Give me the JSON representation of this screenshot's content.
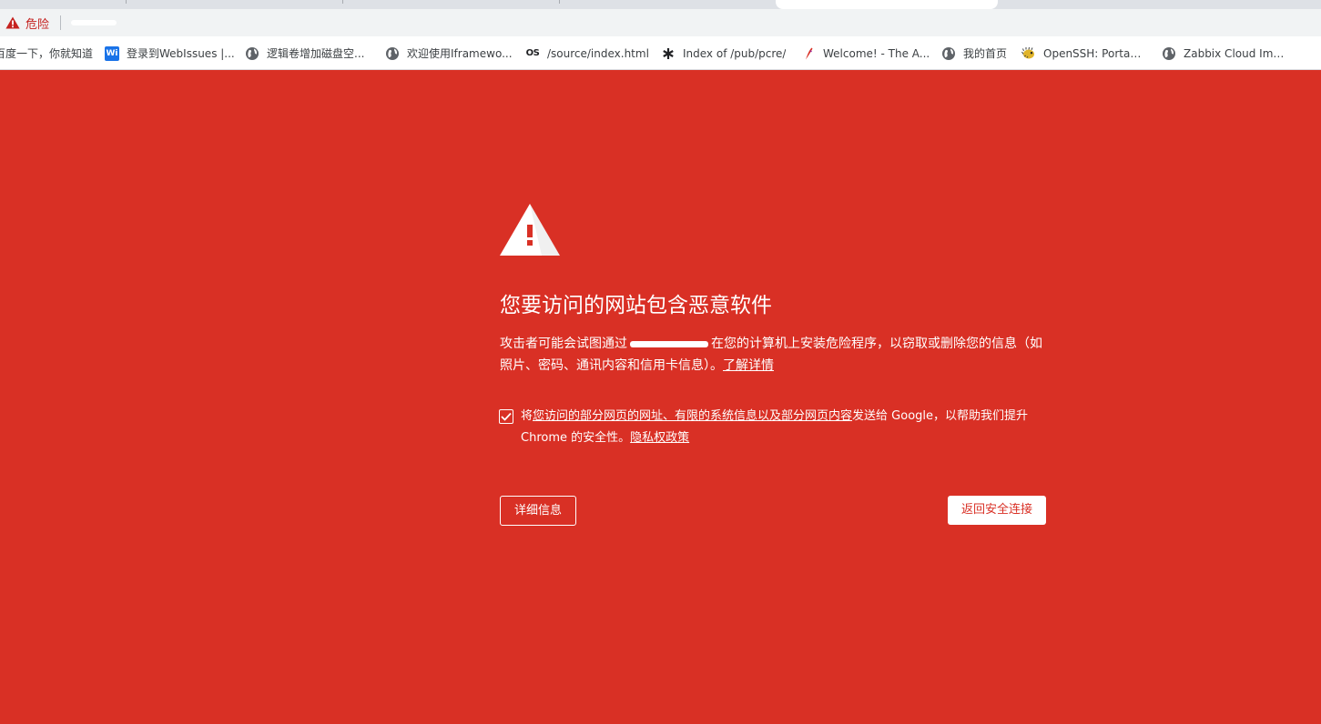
{
  "toolbar": {
    "security_label": "危险"
  },
  "bookmarks": [
    {
      "label": "百度一下，你就知道",
      "icon": "none"
    },
    {
      "label": "登录到WebIssues |...",
      "icon": "webissues-icon",
      "icon_text": "Wi"
    },
    {
      "label": "逻辑卷增加磁盘空...",
      "icon": "globe-icon"
    },
    {
      "label": "欢迎使用Iframewo...",
      "icon": "globe-icon"
    },
    {
      "label": "/source/index.html",
      "icon": "os-icon",
      "icon_text": "OS"
    },
    {
      "label": "Index of /pub/pcre/",
      "icon": "asterisk-icon"
    },
    {
      "label": "Welcome! - The A...",
      "icon": "feather-icon"
    },
    {
      "label": "我的首页",
      "icon": "globe-icon"
    },
    {
      "label": "OpenSSH: Portabl...",
      "icon": "pufferfish-icon"
    },
    {
      "label": "Zabbix Cloud Ima...",
      "icon": "globe-icon"
    }
  ],
  "interstitial": {
    "heading": "您要访问的网站包含恶意软件",
    "message_before": "攻击者可能会试图通过",
    "message_after": "在您的计算机上安装危险程序，以窃取或删除您的信息（如照片、密码、通讯内容和信用卡信息）。",
    "learn_more": "了解详情",
    "optin_prefix": "将",
    "optin_link": "您访问的部分网页的网址、有限的系统信息以及部分网页内容",
    "optin_suffix": "发送给 Google，以帮助我们提升 Chrome 的安全性。",
    "privacy_link": "隐私权政策",
    "optin_checked": true,
    "details_button": "详细信息",
    "back_button": "返回安全连接"
  },
  "colors": {
    "danger_red": "#d93025",
    "white": "#ffffff"
  }
}
